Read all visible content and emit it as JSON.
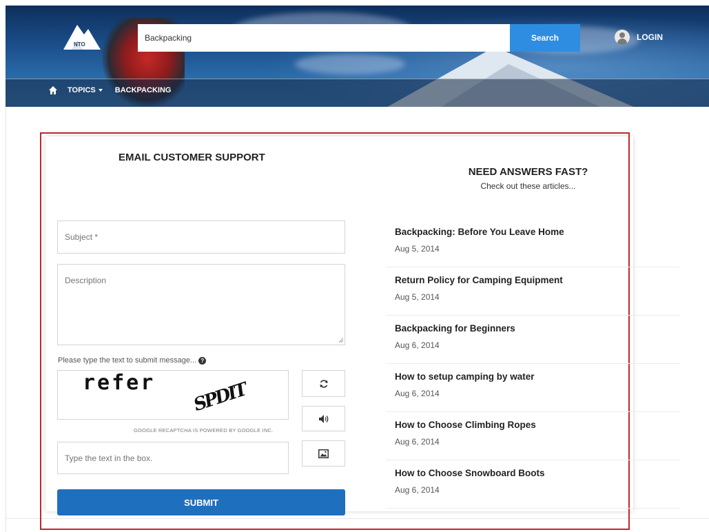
{
  "header": {
    "logo_text": "NTO",
    "search_value": "Backpacking",
    "search_button": "Search",
    "login_label": "LOGIN",
    "nav": {
      "topics_label": "TOPICS",
      "backpacking_label": "BACKPACKING"
    }
  },
  "form": {
    "title": "EMAIL CUSTOMER SUPPORT",
    "subject_placeholder": "Subject *",
    "description_placeholder": "Description",
    "captcha_prompt": "Please type the text to submit message...",
    "captcha_word_1": "refer",
    "captcha_word_2": "SPDIT",
    "captcha_credit": "GOOGLE RECAPTCHA IS POWERED BY GOOGLE INC.",
    "captcha_placeholder": "Type the text in the box.",
    "submit_label": "SUBMIT"
  },
  "articles_panel": {
    "title": "NEED ANSWERS FAST?",
    "subtitle": "Check out these articles...",
    "items": [
      {
        "title": "Backpacking: Before You Leave Home",
        "date": "Aug 5, 2014"
      },
      {
        "title": "Return Policy for Camping Equipment",
        "date": "Aug 5, 2014"
      },
      {
        "title": "Backpacking for Beginners",
        "date": "Aug 6, 2014"
      },
      {
        "title": "How to setup camping by water",
        "date": "Aug 6, 2014"
      },
      {
        "title": "How to Choose Climbing Ropes",
        "date": "Aug 6, 2014"
      },
      {
        "title": "How to Choose Snowboard Boots",
        "date": "Aug 6, 2014"
      }
    ]
  },
  "colors": {
    "search_button": "#2e8de0",
    "submit_button": "#1f6fbf",
    "highlight_border": "#c0262a"
  }
}
